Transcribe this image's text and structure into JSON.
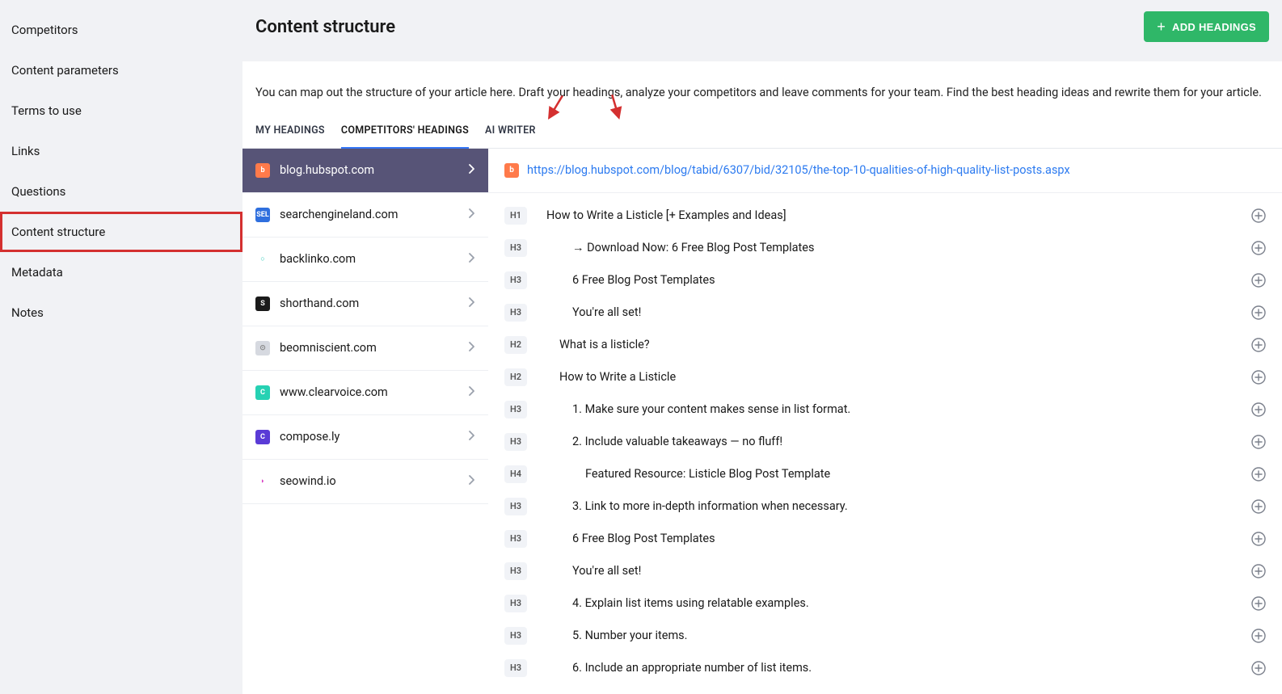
{
  "sidebar": {
    "items": [
      {
        "label": "Competitors",
        "name": "sidebar-item-competitors"
      },
      {
        "label": "Content parameters",
        "name": "sidebar-item-content-parameters"
      },
      {
        "label": "Terms to use",
        "name": "sidebar-item-terms-to-use"
      },
      {
        "label": "Links",
        "name": "sidebar-item-links"
      },
      {
        "label": "Questions",
        "name": "sidebar-item-questions"
      },
      {
        "label": "Content structure",
        "name": "sidebar-item-content-structure"
      },
      {
        "label": "Metadata",
        "name": "sidebar-item-metadata"
      },
      {
        "label": "Notes",
        "name": "sidebar-item-notes"
      }
    ],
    "active_index": 5
  },
  "header": {
    "title": "Content structure",
    "add_button_label": "ADD HEADINGS"
  },
  "description": "You can map out the structure of your article here. Draft your headings, analyze your competitors and leave comments for your team. Find the best heading ideas and rewrite them for your article.",
  "tabs": [
    {
      "label": "MY HEADINGS",
      "name": "tab-my-headings"
    },
    {
      "label": "COMPETITORS' HEADINGS",
      "name": "tab-competitors-headings"
    },
    {
      "label": "AI WRITER",
      "name": "tab-ai-writer"
    }
  ],
  "active_tab_index": 1,
  "competitors": [
    {
      "domain": "blog.hubspot.com",
      "icon_bg": "#ff7a4a",
      "icon_text": "b",
      "text_color": "#fff"
    },
    {
      "domain": "searchengineland.com",
      "icon_bg": "#2f6fde",
      "icon_text": "SEL",
      "text_color": "#fff"
    },
    {
      "domain": "backlinko.com",
      "icon_bg": "#ffffff",
      "icon_text": "○",
      "text_color": "#28c8b6"
    },
    {
      "domain": "shorthand.com",
      "icon_bg": "#1a1a1a",
      "icon_text": "S",
      "text_color": "#fff"
    },
    {
      "domain": "beomniscient.com",
      "icon_bg": "#d6d9e0",
      "icon_text": "⊙",
      "text_color": "#888"
    },
    {
      "domain": "www.clearvoice.com",
      "icon_bg": "#26d1b3",
      "icon_text": "C",
      "text_color": "#fff"
    },
    {
      "domain": "compose.ly",
      "icon_bg": "#5a3bd6",
      "icon_text": "C",
      "text_color": "#fff"
    },
    {
      "domain": "seowind.io",
      "icon_bg": "#ffffff",
      "icon_text": "◗",
      "text_color": "#d941c4"
    }
  ],
  "selected_competitor_index": 0,
  "source": {
    "url": "https://blog.hubspot.com/blog/tabid/6307/bid/32105/the-top-10-qualities-of-high-quality-list-posts.aspx",
    "favicon_text": "b",
    "favicon_bg": "#ff7a4a"
  },
  "headings": [
    {
      "tag": "H1",
      "text": "How to Write a Listicle [+ Examples and Ideas]",
      "indent": 0
    },
    {
      "tag": "H3",
      "text": "→ Download Now: 6 Free Blog Post Templates",
      "indent": 2
    },
    {
      "tag": "H3",
      "text": "6 Free Blog Post Templates",
      "indent": 2
    },
    {
      "tag": "H3",
      "text": "You're all set!",
      "indent": 2
    },
    {
      "tag": "H2",
      "text": "What is a listicle?",
      "indent": 1
    },
    {
      "tag": "H2",
      "text": "How to Write a Listicle",
      "indent": 1
    },
    {
      "tag": "H3",
      "text": "1. Make sure your content makes sense in list format.",
      "indent": 2
    },
    {
      "tag": "H3",
      "text": "2. Include valuable takeaways — no fluff!",
      "indent": 2
    },
    {
      "tag": "H4",
      "text": "Featured Resource: Listicle Blog Post Template",
      "indent": 3
    },
    {
      "tag": "H3",
      "text": "3. Link to more in-depth information when necessary.",
      "indent": 2
    },
    {
      "tag": "H3",
      "text": "6 Free Blog Post Templates",
      "indent": 2
    },
    {
      "tag": "H3",
      "text": "You're all set!",
      "indent": 2
    },
    {
      "tag": "H3",
      "text": "4. Explain list items using relatable examples.",
      "indent": 2
    },
    {
      "tag": "H3",
      "text": "5. Number your items.",
      "indent": 2
    },
    {
      "tag": "H3",
      "text": "6. Include an appropriate number of list items.",
      "indent": 2
    }
  ],
  "colors": {
    "accent": "#3476f6",
    "cta": "#2fb768",
    "highlight_border": "#d43030",
    "selected_row": "#575477"
  }
}
